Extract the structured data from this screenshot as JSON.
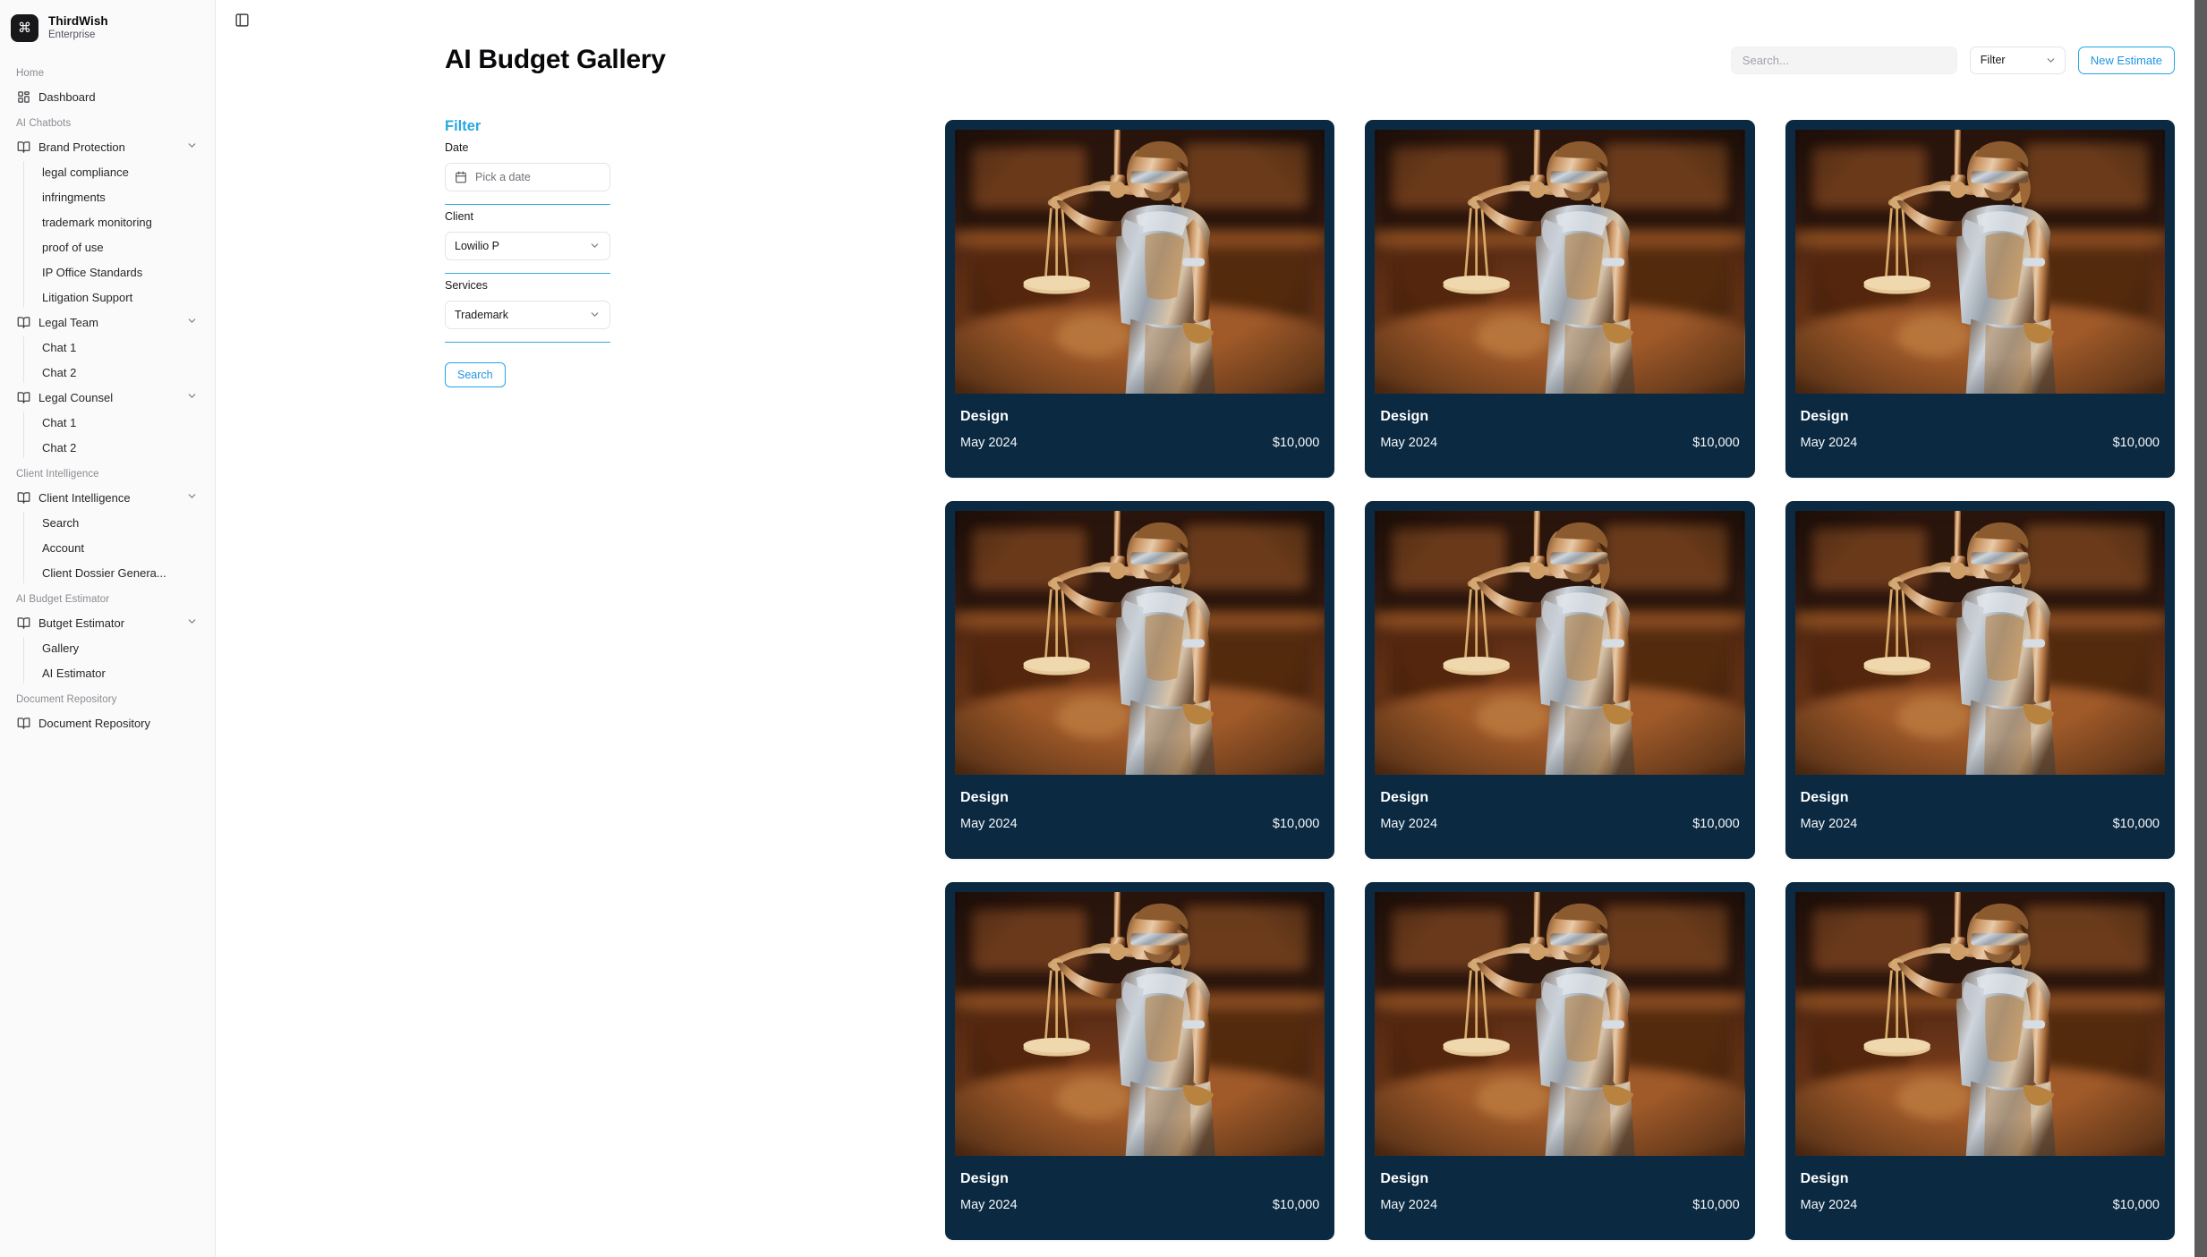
{
  "brand": {
    "logo_glyph": "⌘",
    "name": "ThirdWish",
    "plan": "Enterprise",
    "logo_bg": "#18181b"
  },
  "sidebar": {
    "sections": [
      {
        "label": "Home",
        "items": [
          {
            "label": "Dashboard",
            "icon": "grid-icon",
            "expandable": false,
            "children": []
          }
        ]
      },
      {
        "label": "AI Chatbots",
        "items": [
          {
            "label": "Brand Protection",
            "icon": "book-icon",
            "expandable": true,
            "children": [
              "legal compliance",
              "infringments",
              "trademark monitoring",
              "proof of use",
              "IP Office Standards",
              "Litigation Support"
            ]
          },
          {
            "label": "Legal Team",
            "icon": "book-icon",
            "expandable": true,
            "children": [
              "Chat 1",
              "Chat 2"
            ]
          },
          {
            "label": "Legal Counsel",
            "icon": "book-icon",
            "expandable": true,
            "children": [
              "Chat 1",
              "Chat 2"
            ]
          }
        ]
      },
      {
        "label": "Client Intelligence",
        "items": [
          {
            "label": "Client Intelligence",
            "icon": "book-icon",
            "expandable": true,
            "children": [
              "Search",
              "Account",
              "Client Dossier Genera..."
            ]
          }
        ]
      },
      {
        "label": "AI Budget Estimator",
        "items": [
          {
            "label": "Butget Estimator",
            "icon": "book-icon",
            "expandable": true,
            "children": [
              "Gallery",
              "AI Estimator"
            ]
          }
        ]
      },
      {
        "label": "Document Repository",
        "items": [
          {
            "label": "Document Repository",
            "icon": "book-icon",
            "expandable": false,
            "children": []
          }
        ]
      }
    ]
  },
  "header": {
    "panel_toggle_icon": "panel-left-icon",
    "title": "AI Budget Gallery",
    "search_placeholder": "Search...",
    "search_value": "",
    "filter_label": "Filter",
    "new_estimate_label": "New Estimate",
    "accent_color": "#22a5e8"
  },
  "filter_panel": {
    "heading": "Filter",
    "accent_color": "#29a8e0",
    "date": {
      "label": "Date",
      "placeholder": "Pick a date",
      "value": "",
      "icon": "calendar-icon"
    },
    "client": {
      "label": "Client",
      "value": "Lowilio P",
      "icon": "chevron-down-icon"
    },
    "services": {
      "label": "Services",
      "value": "Trademark",
      "icon": "chevron-down-icon"
    },
    "search_button": "Search"
  },
  "gallery": {
    "card_bg": "#0b2a42",
    "cards": [
      {
        "title": "Design",
        "date": "May 2024",
        "price": "$10,000"
      },
      {
        "title": "Design",
        "date": "May 2024",
        "price": "$10,000"
      },
      {
        "title": "Design",
        "date": "May 2024",
        "price": "$10,000"
      },
      {
        "title": "Design",
        "date": "May 2024",
        "price": "$10,000"
      },
      {
        "title": "Design",
        "date": "May 2024",
        "price": "$10,000"
      },
      {
        "title": "Design",
        "date": "May 2024",
        "price": "$10,000"
      },
      {
        "title": "Design",
        "date": "May 2024",
        "price": "$10,000"
      },
      {
        "title": "Design",
        "date": "May 2024",
        "price": "$10,000"
      },
      {
        "title": "Design",
        "date": "May 2024",
        "price": "$10,000"
      }
    ]
  }
}
